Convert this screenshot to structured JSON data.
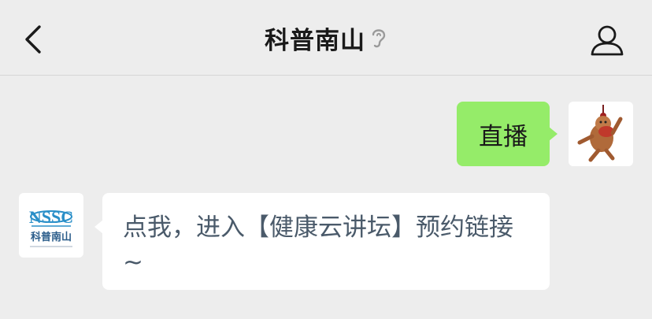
{
  "header": {
    "title": "科普南山",
    "back_icon": "back-chevron-icon",
    "status_icon": "ear-icon",
    "profile_icon": "person-icon"
  },
  "messages": [
    {
      "side": "right",
      "text": "直播",
      "avatar": "cartoon-bear-avatar",
      "bubble_color": "#95ec69"
    },
    {
      "side": "left",
      "text": "点我，进入【健康云讲坛】预约链接~",
      "avatar": "kepu-nanshan-logo",
      "bubble_color": "#ffffff"
    }
  ],
  "left_avatar": {
    "logo_text": "科普南山"
  },
  "colors": {
    "background": "#ededed",
    "link_text": "#4a5a6a",
    "logo_blue": "#2a8fc8"
  }
}
